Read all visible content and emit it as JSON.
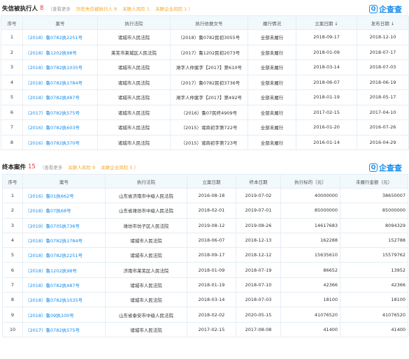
{
  "brand": {
    "icon": "Q",
    "text": "企查查"
  },
  "section1": {
    "title": "失信被执行人",
    "count": "8",
    "view_more": "（查看更多",
    "links": [
      "历史失信被执行人 8",
      "关联人风险 1",
      "关联企业风险 1 ）"
    ],
    "headers": [
      "序号",
      "案号",
      "执行法院",
      "执行依据文号",
      "履行情况",
      "立案日期 ↓",
      "发布日期 ↓"
    ],
    "rows": [
      [
        "1",
        "（2018）鲁0782执2251号",
        "诸城市人民法院",
        "（2018）鲁0782民初3055号",
        "全部未履行",
        "2018-09-17",
        "2018-12-10"
      ],
      [
        "2",
        "（2018）鲁1202执98号",
        "莱芜市莱城区人民法院",
        "（2017）鲁1202民初2073号",
        "全部未履行",
        "2018-01-09",
        "2018-07-17"
      ],
      [
        "3",
        "（2018）鲁0782执1035号",
        "诸城市人民法院",
        "潍字人仲案字【2017】第610号",
        "全部未履行",
        "2018-03-14",
        "2018-07-03"
      ],
      [
        "4",
        "（2018）鲁0782执1784号",
        "诸城市人民法院",
        "（2017）鲁0782民初3736号",
        "全部未履行",
        "2018-06-07",
        "2018-06-19"
      ],
      [
        "5",
        "（2018）鲁0782执487号",
        "诸城市人民法院",
        "潍字人仲案字【2017】第492号",
        "全部未履行",
        "2018-01-19",
        "2018-05-17"
      ],
      [
        "6",
        "（2017）鲁0782执575号",
        "诸城市人民法院",
        "（2016）鲁07民终4909号",
        "全部未履行",
        "2017-02-15",
        "2017-04-10"
      ],
      [
        "7",
        "（2016）鲁0782执603号",
        "诸城市人民法院",
        "（2015）诸商初字第722号",
        "全部未履行",
        "2016-01-20",
        "2016-07-26"
      ],
      [
        "8",
        "（2016）鲁0782执370号",
        "诸城市人民法院",
        "（2015）诸商初字第723号",
        "全部未履行",
        "2016-01-14",
        "2016-04-29"
      ]
    ]
  },
  "section2": {
    "title": "终本案件",
    "count": "15",
    "view_more": "（查看更多",
    "links": [
      "关联人风险 9",
      "关联企业风险 5 ）"
    ],
    "headers": [
      "序号",
      "案号",
      "执行法院",
      "立案日期",
      "终本日期",
      "执行标的（元）",
      "未履行金额（元）"
    ],
    "rows": [
      [
        "1",
        "（2016）鲁01执662号",
        "山东省济南市中级人民法院",
        "2016-08-18",
        "2019-07-02",
        "40000000",
        "38650007"
      ],
      [
        "2",
        "（2018）鲁07执68号",
        "山东省潍坊市中级人民法院",
        "2018-02-01",
        "2019-07-01",
        "85000000",
        "85000000"
      ],
      [
        "3",
        "（2019）鲁0705执736号",
        "潍坊市坊子区人民法院",
        "2019-08-12",
        "2019-08-26",
        "14617683",
        "8094329"
      ],
      [
        "4",
        "（2018）鲁0782执1784号",
        "诸城市人民法院",
        "2018-06-07",
        "2018-12-13",
        "162288",
        "152788"
      ],
      [
        "5",
        "（2018）鲁0782执2251号",
        "诸城市人民法院",
        "2018-09-17",
        "2018-12-12",
        "15635610",
        "15579762"
      ],
      [
        "6",
        "（2018）鲁1202执98号",
        "济南市莱芜区人民法院",
        "2018-01-09",
        "2018-07-19",
        "86652",
        "13952"
      ],
      [
        "7",
        "（2018）鲁0782执487号",
        "诸城市人民法院",
        "2018-01-19",
        "2018-07-10",
        "42366",
        "42366"
      ],
      [
        "8",
        "（2018）鲁0782执1035号",
        "诸城市人民法院",
        "2018-03-14",
        "2018-07-03",
        "18100",
        "18100"
      ],
      [
        "9",
        "（2018）鲁09执100号",
        "山东省泰安市中级人民法院",
        "2018-02-02",
        "2020-05-15",
        "41076520",
        "41076520"
      ],
      [
        "10",
        "（2017）鲁0782执575号",
        "诸城市人民法院",
        "2017-02-15",
        "2017-08-08",
        "41400",
        "41400"
      ]
    ]
  }
}
